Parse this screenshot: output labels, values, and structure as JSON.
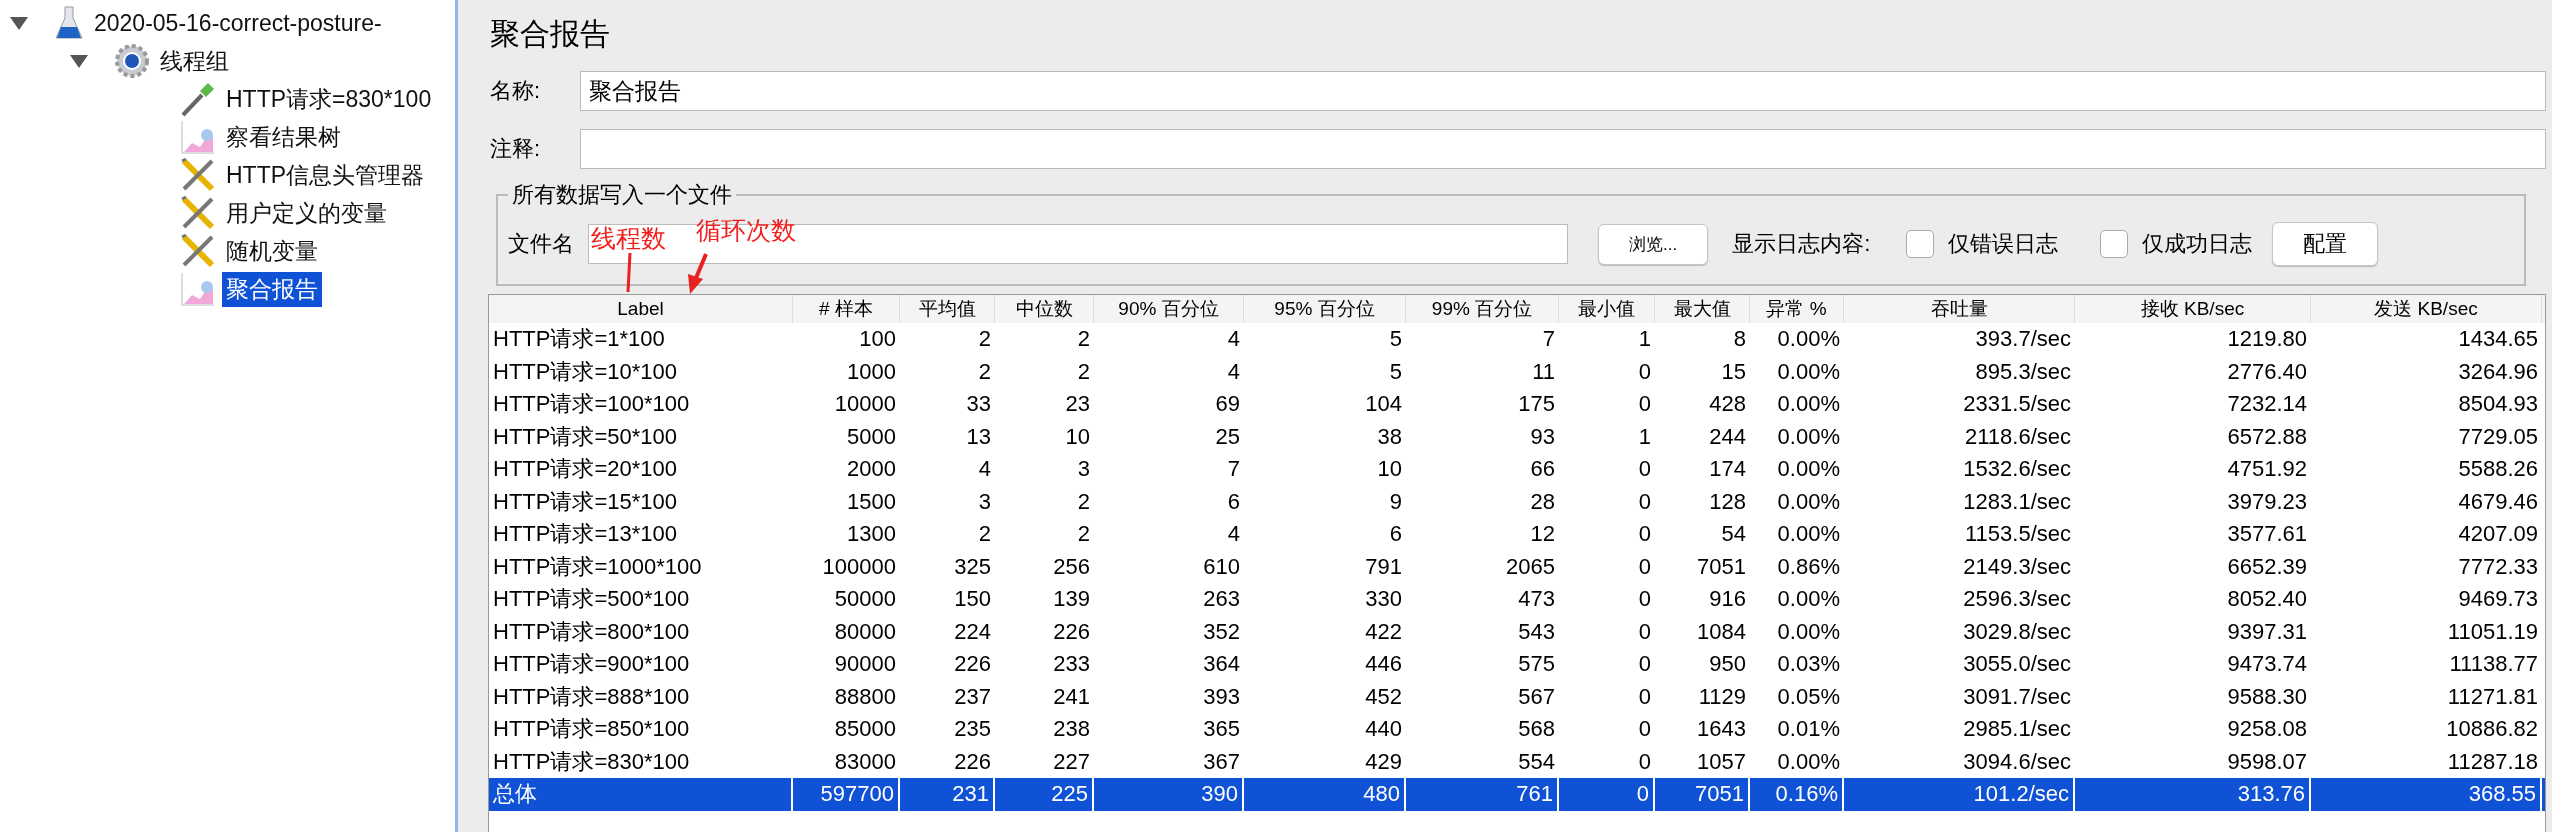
{
  "tree": [
    {
      "label": "2020-05-16-correct-posture-",
      "kind": "flask",
      "expanded": true,
      "selected": false,
      "children": [
        {
          "label": "线程组",
          "kind": "gear",
          "expanded": true,
          "selected": false,
          "children": [
            {
              "label": "HTTP请求=830*100",
              "kind": "dropper",
              "selected": false
            },
            {
              "label": "察看结果树",
              "kind": "chart",
              "selected": false
            },
            {
              "label": "HTTP信息头管理器",
              "kind": "tools",
              "selected": false
            },
            {
              "label": "用户定义的变量",
              "kind": "tools",
              "selected": false
            },
            {
              "label": "随机变量",
              "kind": "tools",
              "selected": false
            },
            {
              "label": "聚合报告",
              "kind": "chart",
              "selected": true
            }
          ]
        }
      ]
    }
  ],
  "panel": {
    "title": "聚合报告",
    "name_field": {
      "label": "名称:",
      "value": "聚合报告"
    },
    "comment_field": {
      "label": "注释:"
    },
    "file_group": {
      "legend": "所有数据写入一个文件",
      "file_label": "文件名",
      "browse_button": "浏览...",
      "log_label": "显示日志内容:",
      "checkboxes": [
        {
          "label": "仅错误日志",
          "checked": false
        },
        {
          "label": "仅成功日志",
          "checked": false
        }
      ],
      "config_button": "配置"
    },
    "annotations": [
      {
        "text": "线程数"
      },
      {
        "text": "循环次数"
      }
    ]
  },
  "table": {
    "columns": [
      "Label",
      "# 样本",
      "平均值",
      "中位数",
      "90% 百分位",
      "95% 百分位",
      "99% 百分位",
      "最小值",
      "最大值",
      "异常 %",
      "吞吐量",
      "接收 KB/sec",
      "发送 KB/sec"
    ],
    "rows": [
      {
        "selected": false,
        "cells": [
          "HTTP请求=1*100",
          "100",
          "2",
          "2",
          "4",
          "5",
          "7",
          "1",
          "8",
          "0.00%",
          "393.7/sec",
          "1219.80",
          "1434.65"
        ]
      },
      {
        "selected": false,
        "cells": [
          "HTTP请求=10*100",
          "1000",
          "2",
          "2",
          "4",
          "5",
          "11",
          "0",
          "15",
          "0.00%",
          "895.3/sec",
          "2776.40",
          "3264.96"
        ]
      },
      {
        "selected": false,
        "cells": [
          "HTTP请求=100*100",
          "10000",
          "33",
          "23",
          "69",
          "104",
          "175",
          "0",
          "428",
          "0.00%",
          "2331.5/sec",
          "7232.14",
          "8504.93"
        ]
      },
      {
        "selected": false,
        "cells": [
          "HTTP请求=50*100",
          "5000",
          "13",
          "10",
          "25",
          "38",
          "93",
          "1",
          "244",
          "0.00%",
          "2118.6/sec",
          "6572.88",
          "7729.05"
        ]
      },
      {
        "selected": false,
        "cells": [
          "HTTP请求=20*100",
          "2000",
          "4",
          "3",
          "7",
          "10",
          "66",
          "0",
          "174",
          "0.00%",
          "1532.6/sec",
          "4751.92",
          "5588.26"
        ]
      },
      {
        "selected": false,
        "cells": [
          "HTTP请求=15*100",
          "1500",
          "3",
          "2",
          "6",
          "9",
          "28",
          "0",
          "128",
          "0.00%",
          "1283.1/sec",
          "3979.23",
          "4679.46"
        ]
      },
      {
        "selected": false,
        "cells": [
          "HTTP请求=13*100",
          "1300",
          "2",
          "2",
          "4",
          "6",
          "12",
          "0",
          "54",
          "0.00%",
          "1153.5/sec",
          "3577.61",
          "4207.09"
        ]
      },
      {
        "selected": false,
        "cells": [
          "HTTP请求=1000*100",
          "100000",
          "325",
          "256",
          "610",
          "791",
          "2065",
          "0",
          "7051",
          "0.86%",
          "2149.3/sec",
          "6652.39",
          "7772.33"
        ]
      },
      {
        "selected": false,
        "cells": [
          "HTTP请求=500*100",
          "50000",
          "150",
          "139",
          "263",
          "330",
          "473",
          "0",
          "916",
          "0.00%",
          "2596.3/sec",
          "8052.40",
          "9469.73"
        ]
      },
      {
        "selected": false,
        "cells": [
          "HTTP请求=800*100",
          "80000",
          "224",
          "226",
          "352",
          "422",
          "543",
          "0",
          "1084",
          "0.00%",
          "3029.8/sec",
          "9397.31",
          "11051.19"
        ]
      },
      {
        "selected": false,
        "cells": [
          "HTTP请求=900*100",
          "90000",
          "226",
          "233",
          "364",
          "446",
          "575",
          "0",
          "950",
          "0.03%",
          "3055.0/sec",
          "9473.74",
          "11138.77"
        ]
      },
      {
        "selected": false,
        "cells": [
          "HTTP请求=888*100",
          "88800",
          "237",
          "241",
          "393",
          "452",
          "567",
          "0",
          "1129",
          "0.05%",
          "3091.7/sec",
          "9588.30",
          "11271.81"
        ]
      },
      {
        "selected": false,
        "cells": [
          "HTTP请求=850*100",
          "85000",
          "235",
          "238",
          "365",
          "440",
          "568",
          "0",
          "1643",
          "0.01%",
          "2985.1/sec",
          "9258.08",
          "10886.82"
        ]
      },
      {
        "selected": false,
        "cells": [
          "HTTP请求=830*100",
          "83000",
          "226",
          "227",
          "367",
          "429",
          "554",
          "0",
          "1057",
          "0.00%",
          "3094.6/sec",
          "9598.07",
          "11287.18"
        ]
      },
      {
        "selected": true,
        "cells": [
          "总体",
          "597700",
          "231",
          "225",
          "390",
          "480",
          "761",
          "0",
          "7051",
          "0.16%",
          "101.2/sec",
          "313.76",
          "368.55"
        ]
      }
    ]
  }
}
